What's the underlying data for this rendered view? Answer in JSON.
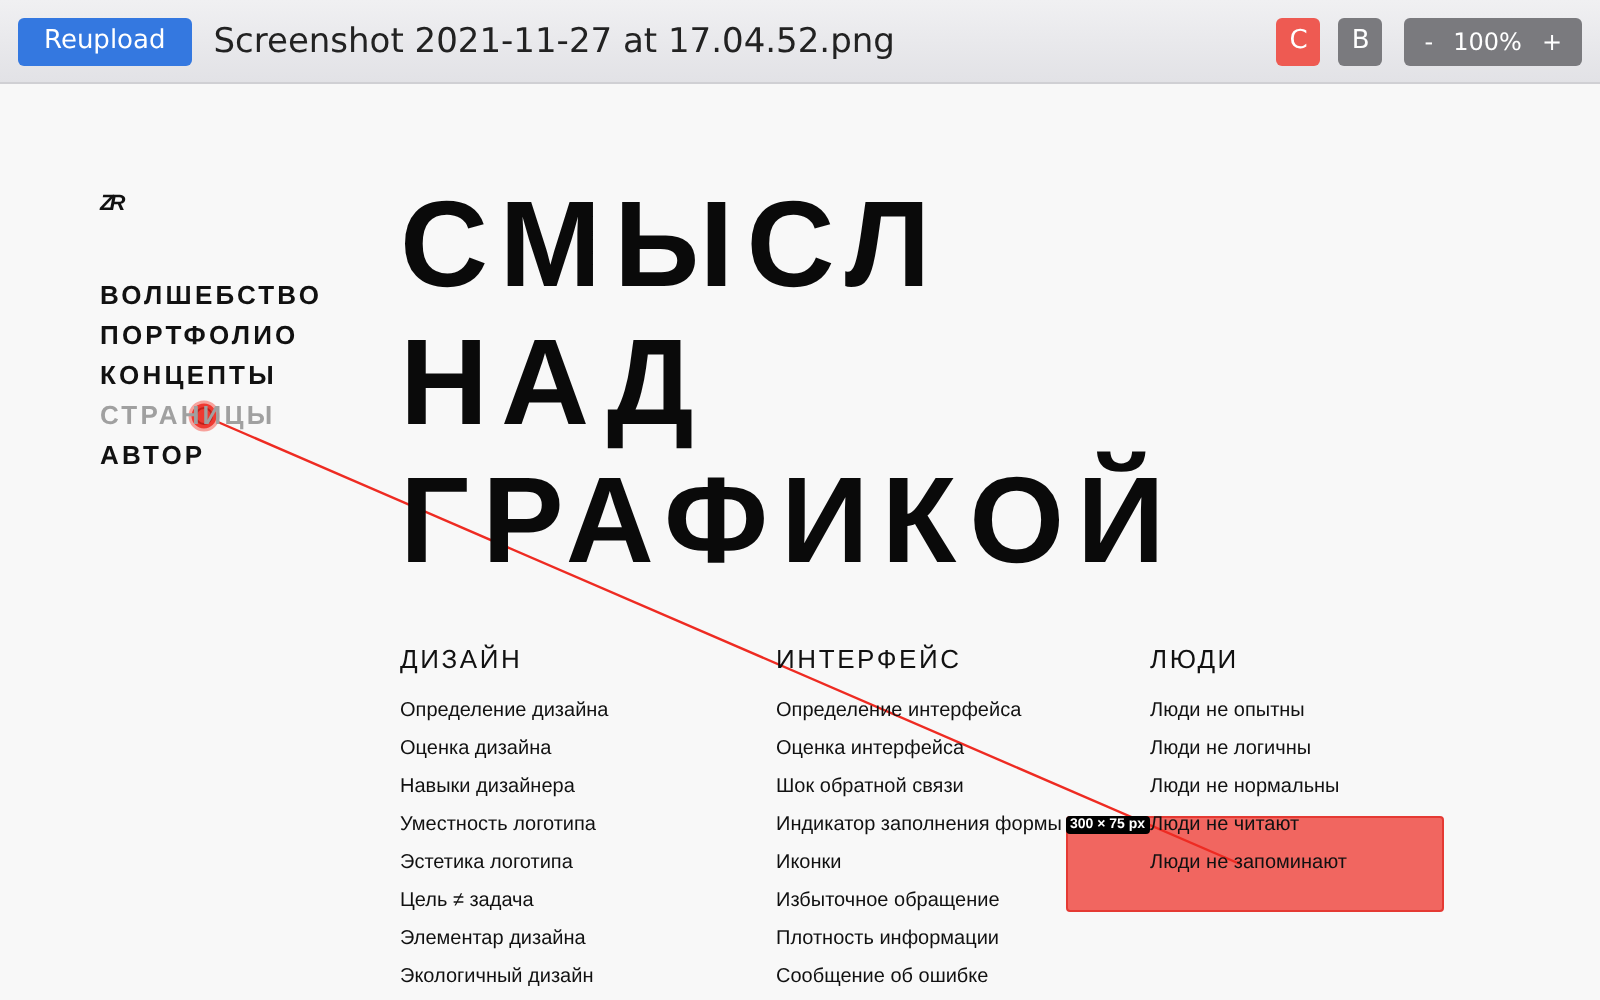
{
  "toolbar": {
    "reupload": "Reupload",
    "file_name": "Screenshot 2021-11-27 at 17.04.52.png",
    "modes": [
      {
        "label": "C",
        "selected": true
      },
      {
        "label": "B",
        "selected": false
      }
    ],
    "zoom": {
      "minus": "-",
      "value": "100%",
      "plus": "+"
    }
  },
  "logo": "ZR",
  "nav": [
    {
      "label": "ВОЛШЕБСТВО",
      "selected": false
    },
    {
      "label": "ПОРТФОЛИО",
      "selected": false
    },
    {
      "label": "КОНЦЕПТЫ",
      "selected": false
    },
    {
      "label": "СТРАНИЦЫ",
      "selected": true
    },
    {
      "label": "АВТОР",
      "selected": false
    }
  ],
  "headline": [
    "СМЫСЛ",
    "НАД",
    "ГРАФИКОЙ"
  ],
  "topics": [
    {
      "title": "ДИЗАЙН",
      "items": [
        "Определение дизайна",
        "Оценка дизайна",
        "Навыки дизайнера",
        "Уместность логотипа",
        "Эстетика логотипа",
        "Цель ≠ задача",
        "Элементар дизайна",
        "Экологичный дизайн"
      ]
    },
    {
      "title": "ИНТЕРФЕЙС",
      "items": [
        "Определение интерфейса",
        "Оценка интерфейса",
        "Шок обратной связи",
        "Индикатор заполнения формы",
        "Иконки",
        "Избыточное обращение",
        "Плотность информации",
        "Сообщение об ошибке"
      ]
    },
    {
      "title": "ЛЮДИ",
      "items": [
        "Люди не опытны",
        "Люди не логичны",
        "Люди не нормальны",
        "Люди не читают",
        "Люди не запоминают"
      ]
    }
  ],
  "annotation": {
    "size_label": "300 × 75 px"
  }
}
